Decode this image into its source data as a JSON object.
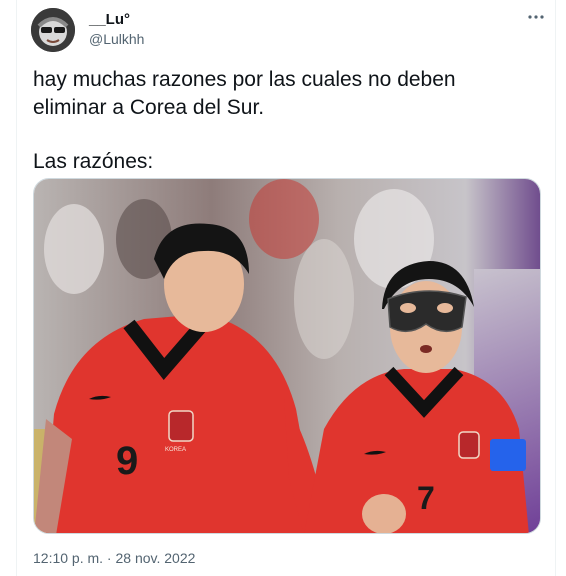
{
  "tweet": {
    "display_name": "__Lu°",
    "handle": "@Lulkhh",
    "more_icon": "more-dots-icon",
    "lines": [
      "hay muchas razones por las cuales no deben eliminar a Corea del Sur.",
      "Las razónes:"
    ],
    "timestamp": "12:10 p. m. · 28 nov. 2022"
  },
  "photo": {
    "player_left_number": "9",
    "player_right_number": "7",
    "badge_text": "KOREA"
  },
  "colors": {
    "jersey_red": "#e0352e",
    "text_primary": "#0f1419",
    "text_secondary": "#536471",
    "border": "#cfd9de"
  }
}
